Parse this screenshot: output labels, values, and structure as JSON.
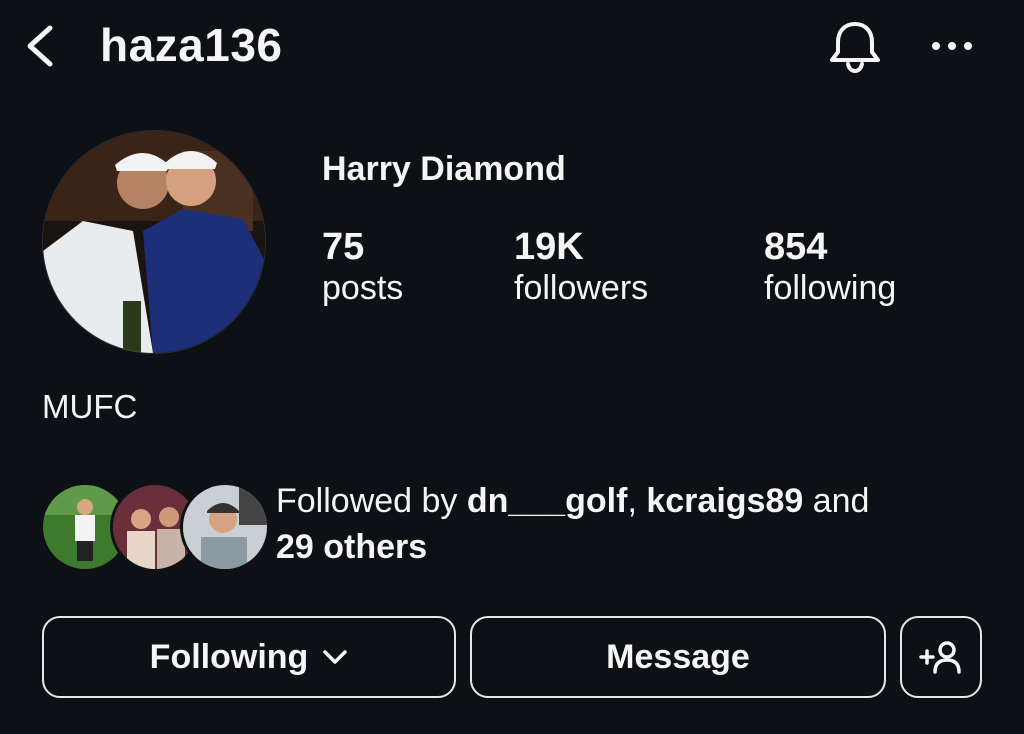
{
  "header": {
    "username": "haza136",
    "back_icon": "chevron-left-icon",
    "bell_icon": "bell-icon",
    "more_icon": "more-horizontal-icon"
  },
  "profile": {
    "full_name": "Harry Diamond",
    "bio": "MUFC",
    "stats": [
      {
        "value": "75",
        "label": "posts"
      },
      {
        "value": "19K",
        "label": "followers"
      },
      {
        "value": "854",
        "label": "following"
      }
    ]
  },
  "mutuals": {
    "prefix": "Followed by ",
    "user1": "dn___golf",
    "sep": ", ",
    "user2": "kcraigs89",
    "and": " and",
    "others": "29 others"
  },
  "actions": {
    "following_label": "Following",
    "message_label": "Message",
    "add_user_icon": "add-user-icon"
  },
  "colors": {
    "background": "#0d1014",
    "text": "#f5f5f5",
    "button_border": "#e8e8e8"
  }
}
